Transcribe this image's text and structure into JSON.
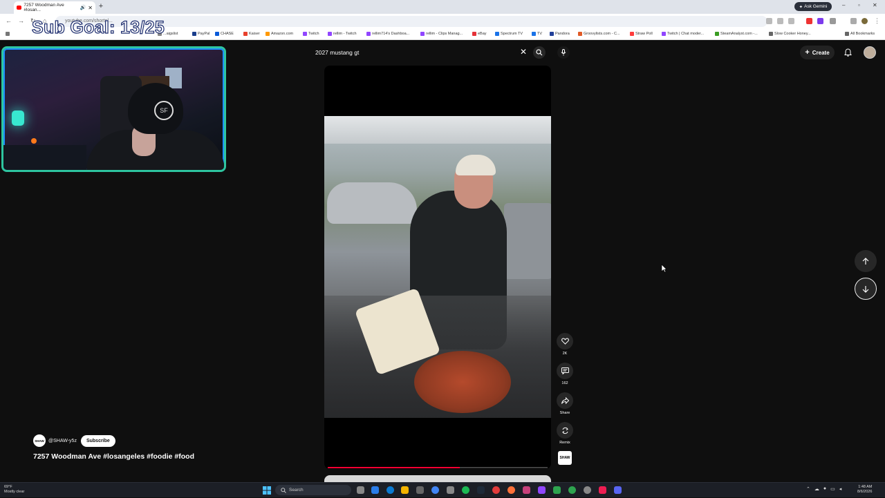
{
  "browser": {
    "tab_title": "7257 Woodman Ave #losan...",
    "ask_gemini": "Ask Gemini",
    "url": "youtube.com/shorts/...",
    "bookmarks": [
      "...aigslist",
      "PayPal",
      "CHASE",
      "Kaiser",
      "Amazon.com",
      "Twitch",
      "rellim - Twitch",
      "rellim714's Dashboa...",
      "rellim - Clips Manag...",
      "eBay",
      "Spectrum TV",
      "TV",
      "Pandora",
      "Groovylists.com - C...",
      "Straw Poll",
      "Twitch | Chat moder...",
      "SteamAnalyst.com -...",
      "Slow Cooker Honey...",
      "All Bookmarks"
    ],
    "bookmark_colors": [
      "#888",
      "#1a3e8c",
      "#0a5ad8",
      "#e8412c",
      "#ff9900",
      "#9146ff",
      "#9146ff",
      "#9146ff",
      "#9146ff",
      "#e53238",
      "#1a73e8",
      "#1a73e8",
      "#224099",
      "#e05a26",
      "#ff3d3d",
      "#9146ff",
      "#3a9d23",
      "#666",
      "#666"
    ]
  },
  "overlay": {
    "sub_goal": "Sub Goal: 13/25",
    "cap_logo": "SF"
  },
  "youtube": {
    "search_query": "2027 mustang gt",
    "create_label": "Create",
    "actions": {
      "likes": "2K",
      "comments": "162",
      "share": "Share",
      "remix": "Remix",
      "channel_thumb": "SHAW"
    },
    "channel_avatar": "SHAW",
    "channel_handle": "@SHAW-y5z",
    "subscribe_label": "Subscribe",
    "video_title": "7257 Woodman Ave #losangeles #foodie #food",
    "progress_fraction": 0.6
  },
  "taskbar": {
    "temperature": "69°F",
    "weather": "Mostly clear",
    "search_label": "Search",
    "time": "1:48 AM",
    "date": "8/6/2026",
    "app_icon_colors": [
      "#2d7ff9",
      "#888",
      "#2b7de9",
      "#f4b400",
      "#4285f4",
      "#666",
      "#1db954",
      "#1e2a38",
      "#e23c3c",
      "#ff7139",
      "#c7417b",
      "#9146ff",
      "#2ea44f",
      "#5865f2",
      "#00f2ea",
      "#7b61ff"
    ]
  }
}
